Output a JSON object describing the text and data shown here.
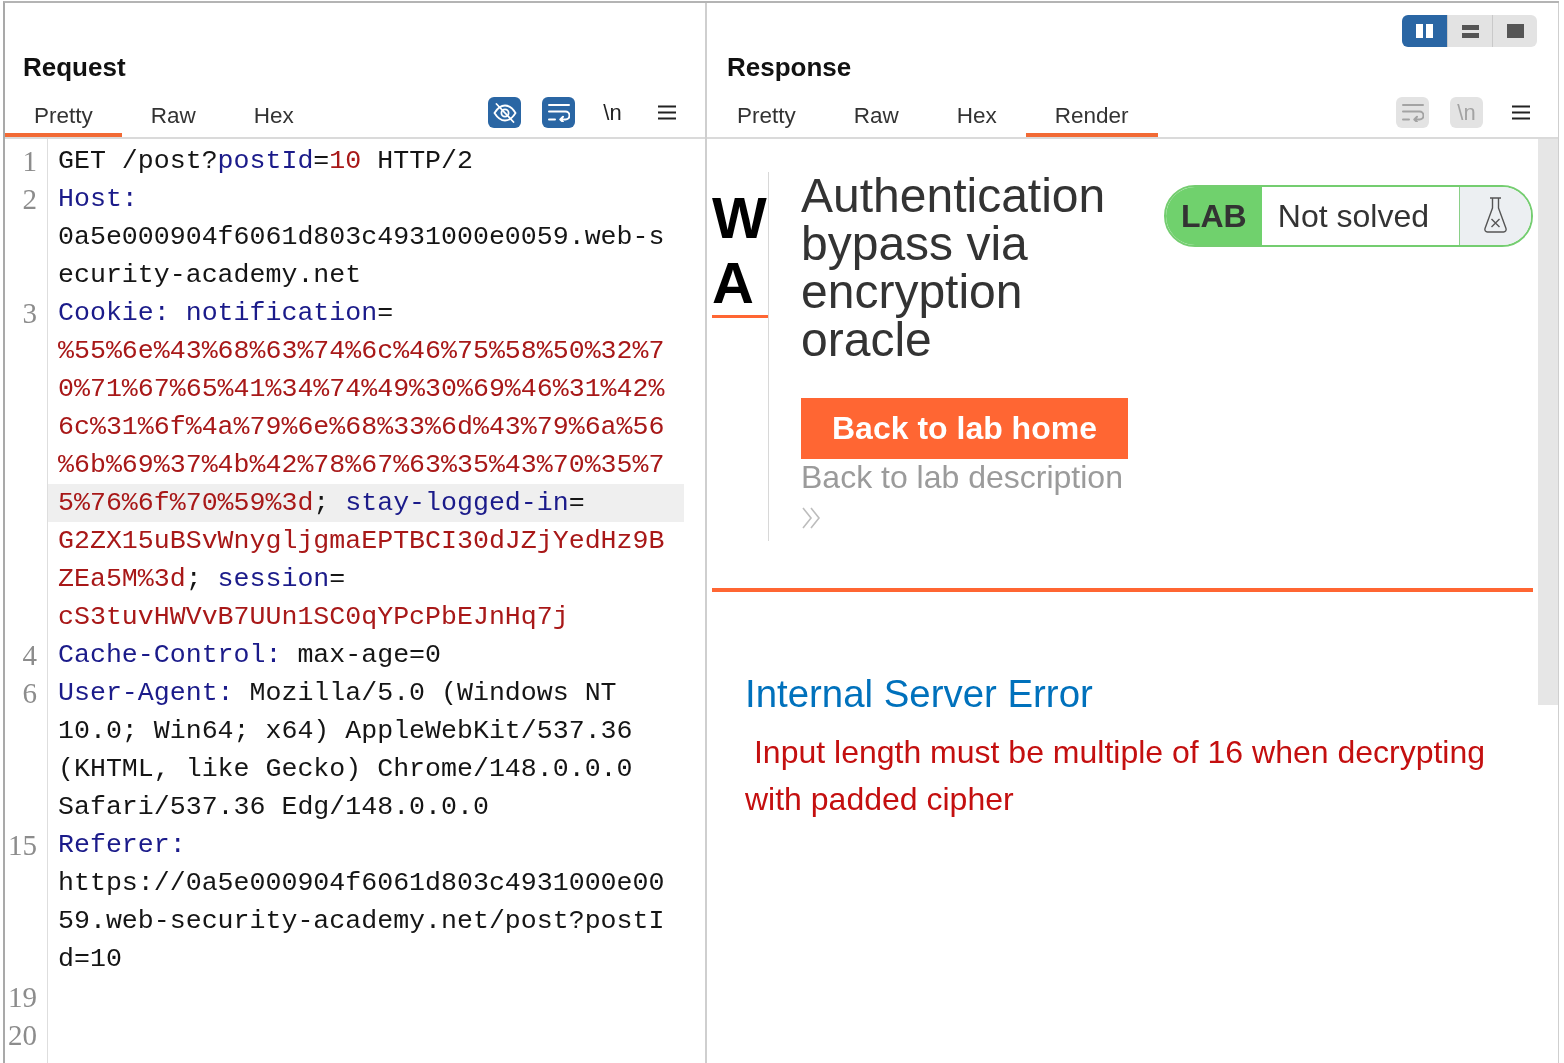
{
  "request": {
    "title": "Request",
    "tabs": [
      {
        "label": "Pretty",
        "selected": true
      },
      {
        "label": "Raw",
        "selected": false
      },
      {
        "label": "Hex",
        "selected": false
      }
    ],
    "toggles": [
      {
        "kind": "hide",
        "on": true,
        "disabled": false
      },
      {
        "kind": "wrap",
        "on": true,
        "disabled": false
      },
      {
        "kind": "newline",
        "label": "\\n",
        "on": false,
        "disabled": false
      }
    ],
    "lines": [
      {
        "number": "1",
        "segments": [
          {
            "kind": "plain",
            "text": "GET /post?"
          },
          {
            "kind": "name",
            "text": "postId"
          },
          {
            "kind": "plain",
            "text": "="
          },
          {
            "kind": "value",
            "text": "10"
          },
          {
            "kind": "plain",
            "text": " HTTP/2"
          }
        ]
      },
      {
        "number": "2",
        "segments": [
          {
            "kind": "name",
            "text": "Host:"
          },
          {
            "kind": "plain",
            "text": " 0a5e000904f6061d803c4931000e0059.web-security-academy.net"
          }
        ]
      },
      {
        "number": "3",
        "segments": [
          {
            "kind": "name",
            "text": "Cookie:"
          },
          {
            "kind": "name",
            "text": " notification"
          },
          {
            "kind": "plain",
            "text": "="
          },
          {
            "kind": "value",
            "text": "%55%6e%43%68%63%74%6c%46%75%58%50%32%70%71%67%65%41%34%74%49%30%69%46%31%42%6c%31%6f%4a%79%6e%68%33%6d%43%79%6a%56%6b%69%37%4b%42%78%67%63%35%43%70%35%75%76%6f%70%59%3d"
          },
          {
            "kind": "plain",
            "text": "; "
          },
          {
            "kind": "name",
            "text": "stay-logged-in",
            "current_row": true
          },
          {
            "kind": "plain",
            "text": "="
          },
          {
            "kind": "value",
            "text": "G2ZX15uBSvWnygljgmaEPTBCI30dJZjYedHz9BZEa5M%3d"
          },
          {
            "kind": "plain",
            "text": "; "
          },
          {
            "kind": "name",
            "text": "session"
          },
          {
            "kind": "plain",
            "text": "="
          },
          {
            "kind": "value",
            "text": "cS3tuvHWVvB7UUn1SC0qYPcPbEJnHq7j"
          }
        ]
      },
      {
        "number": "4",
        "segments": [
          {
            "kind": "name",
            "text": "Cache-Control:"
          },
          {
            "kind": "plain",
            "text": " max-age=0"
          }
        ]
      },
      {
        "number": "6",
        "segments": [
          {
            "kind": "name",
            "text": "User-Agent:"
          },
          {
            "kind": "plain",
            "text": " Mozilla/5.0 (Windows NT 10.0; Win64; x64) AppleWebKit/537.36 (KHTML, like Gecko) Chrome/148.0.0.0 Safari/537.36 Edg/148.0.0.0"
          }
        ]
      },
      {
        "number": "15",
        "segments": [
          {
            "kind": "name",
            "text": "Referer:"
          },
          {
            "kind": "plain",
            "text": " https://0a5e000904f6061d803c4931000e0059.web-security-academy.net/post?postId=10"
          }
        ]
      },
      {
        "number": "19"
      },
      {
        "number": "20"
      }
    ]
  },
  "response": {
    "layout_buttons": [
      {
        "kind": "columns",
        "selected": true
      },
      {
        "kind": "rows",
        "selected": false
      },
      {
        "kind": "single",
        "selected": false
      }
    ],
    "title": "Response",
    "tabs": [
      {
        "label": "Pretty",
        "selected": false
      },
      {
        "label": "Raw",
        "selected": false
      },
      {
        "label": "Hex",
        "selected": false
      },
      {
        "label": "Render",
        "selected": true
      }
    ],
    "toggles": [
      {
        "kind": "wrap",
        "on": false,
        "disabled": true
      },
      {
        "kind": "newline",
        "label": "\\n",
        "on": false,
        "disabled": true
      }
    ],
    "rendered_page": {
      "logo_letters": [
        "W",
        "A"
      ],
      "lab_title": "Authentication bypass via encryption oracle",
      "lab_badge": {
        "label": "LAB",
        "status": "Not solved"
      },
      "home_button": "Back to lab home",
      "description_link": "Back to lab description",
      "error_heading": "Internal Server Error",
      "error_message": "Input length must be multiple of 16 when decrypting with padded cipher"
    }
  }
}
